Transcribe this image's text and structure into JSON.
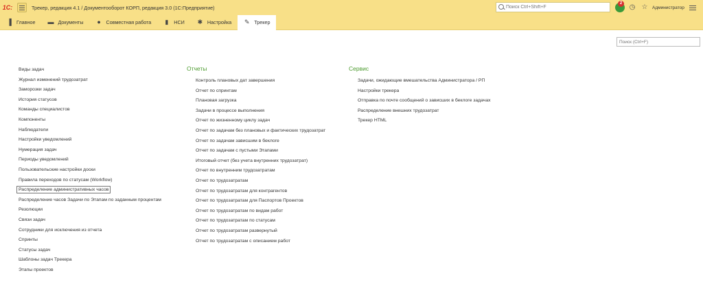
{
  "window": {
    "logo": "1С:",
    "title": "Трекер, редакция 4.1 / Документооборот КОРП, редакция 3.0  (1С:Предприятие)",
    "search_placeholder": "Поиск Ctrl+Shift+F",
    "notification_count": "2",
    "user": "Администратор"
  },
  "sections": [
    {
      "label": "Главное",
      "icon": "home-icon"
    },
    {
      "label": "Документы",
      "icon": "folder-icon"
    },
    {
      "label": "Совместная работа",
      "icon": "people-icon"
    },
    {
      "label": "НСИ",
      "icon": "book-icon"
    },
    {
      "label": "Настройка",
      "icon": "gear-icon"
    },
    {
      "label": "Трекер",
      "icon": "pin-icon",
      "active": true
    }
  ],
  "content_search": {
    "placeholder": "Поиск (Ctrl+F)"
  },
  "left_column": {
    "items": [
      "Виды задач",
      "Журнал изменений трудозатрат",
      "Заморозки задач",
      "История статусов",
      "Команды специалистов",
      "Компоненты",
      "Наблюдатели",
      "Настройки уведомлений",
      "Нумерация задач",
      "Периоды уведомлений",
      "Пользовательские настройки доски",
      "Правила переходов по статусам (Workflow)",
      "Распределение административных часов",
      "Распределение часов Задачи по Этапам по заданным процентам",
      "Резолюции",
      "Связи задач",
      "Сотрудники для исключения из отчета",
      "Спринты",
      "Статусы задач",
      "Шаблоны задач Трекера",
      "Этапы проектов"
    ],
    "focused_index": 12
  },
  "reports_column": {
    "title": "Отчеты",
    "items": [
      "Контроль плановых дат завершения",
      "Отчет по спринтам",
      "Плановая загрузка",
      "Задачи в процессе выполнения",
      "Отчет по жизненному циклу задач",
      "Отчет по задачам без плановых и фактических трудозатрат",
      "Отчет по задачам зависшим в беклоге",
      "Отчет по задачам с пустыми Этапами",
      "Итоговый отчет (без учета внутренних трудозатрат)",
      "Отчет по внутренним трудозатратам",
      "Отчет по трудозатратам",
      "Отчет по трудозатратам для контрагентов",
      "Отчет по трудозатратам для Паспортов Проектов",
      "Отчет по трудозатратам по видам работ",
      "Отчет по трудозатратам по статусам",
      "Отчет по трудозатратам развернутый",
      "Отчет по трудозатратам с описанием работ"
    ]
  },
  "service_column": {
    "title": "Сервис",
    "items": [
      "Задачи, ожидающие вмешательства Администратора / РП",
      "Настройки трекера",
      "Отправка по почте сообщений о зависших в беклоге задачах",
      "Распределение внешних трудозатрат",
      "Трекер HTML"
    ]
  }
}
